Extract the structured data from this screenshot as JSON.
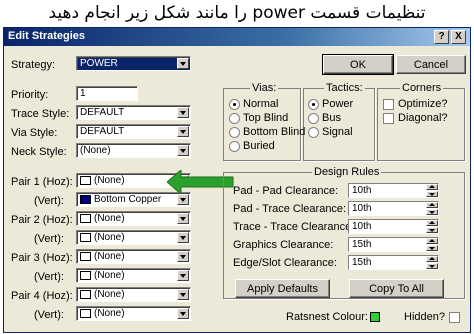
{
  "caption": "تنظیمات قسمت power را مانند شکل زیر انجام دهید",
  "window": {
    "title": "Edit Strategies",
    "help_btn": "?",
    "close_btn": "X"
  },
  "strategy": {
    "label": "Strategy:",
    "value": "POWER"
  },
  "buttons": {
    "ok": "OK",
    "cancel": "Cancel",
    "apply_defaults": "Apply Defaults",
    "copy_to_all": "Copy To All"
  },
  "fields": {
    "priority": {
      "label": "Priority:",
      "value": "1"
    },
    "trace_style": {
      "label": "Trace Style:",
      "value": "DEFAULT"
    },
    "via_style": {
      "label": "Via Style:",
      "value": "DEFAULT"
    },
    "neck_style": {
      "label": "Neck Style:",
      "value": "(None)"
    }
  },
  "pairs": [
    {
      "label": "Pair 1 (Hoz):",
      "value": "(None)",
      "swatch": "#ffffff"
    },
    {
      "label": "(Vert):",
      "value": "Bottom Copper",
      "swatch": "#000080"
    },
    {
      "label": "Pair 2 (Hoz):",
      "value": "(None)",
      "swatch": "#ffffff"
    },
    {
      "label": "(Vert):",
      "value": "(None)",
      "swatch": "#ffffff"
    },
    {
      "label": "Pair 3 (Hoz):",
      "value": "(None)",
      "swatch": "#ffffff"
    },
    {
      "label": "(Vert):",
      "value": "(None)",
      "swatch": "#ffffff"
    },
    {
      "label": "Pair 4 (Hoz):",
      "value": "(None)",
      "swatch": "#ffffff"
    },
    {
      "label": "(Vert):",
      "value": "(None)",
      "swatch": "#ffffff"
    }
  ],
  "vias": {
    "title": "Vias:",
    "options": [
      "Normal",
      "Top Blind",
      "Bottom Blind",
      "Buried"
    ],
    "selected": "Normal"
  },
  "tactics": {
    "title": "Tactics:",
    "options": [
      "Power",
      "Bus",
      "Signal"
    ],
    "selected": "Power"
  },
  "corners": {
    "title": "Corners",
    "options": [
      "Optimize?",
      "Diagonal?"
    ]
  },
  "design_rules": {
    "title": "Design Rules",
    "rows": [
      {
        "label": "Pad - Pad Clearance:",
        "value": "10th"
      },
      {
        "label": "Pad - Trace Clearance:",
        "value": "10th"
      },
      {
        "label": "Trace - Trace Clearance:",
        "value": "10th"
      },
      {
        "label": "Graphics Clearance:",
        "value": "15th"
      },
      {
        "label": "Edge/Slot Clearance:",
        "value": "15th"
      }
    ]
  },
  "ratsnest": {
    "label": "Ratsnest Colour:",
    "color": "#33cc33"
  },
  "hidden": {
    "label": "Hidden?"
  },
  "colors": {
    "title_start": "#0a246a",
    "arrow": "#2ca02c",
    "face": "#ece9d8"
  }
}
